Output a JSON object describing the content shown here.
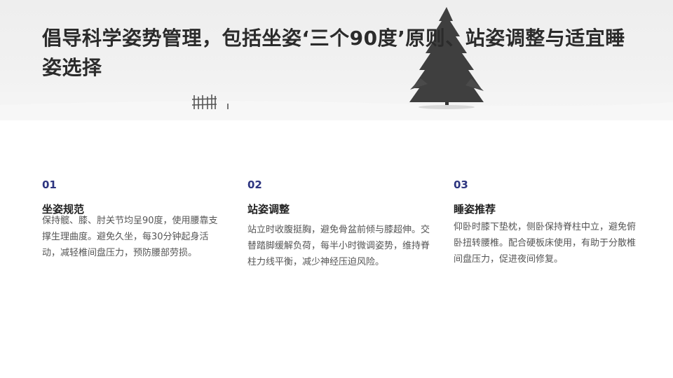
{
  "slide": {
    "title": "倡导科学姿势管理，包括坐姿‘三个90度’原则、站姿调整与适宜睡姿选择"
  },
  "hero_image": {
    "description_icon": "tree-icon",
    "fence_icon": "fence-icon"
  },
  "columns": [
    {
      "number": "01",
      "heading": "坐姿规范",
      "text": "保持髋、膝、肘关节均呈90度，使用腰靠支撑生理曲度。避免久坐，每30分钟起身活动，减轻椎间盘压力，预防腰部劳损。"
    },
    {
      "number": "02",
      "heading": "站姿调整",
      "text": "站立时收腹挺胸，避免骨盆前倾与膝超伸。交替踏脚缓解负荷，每半小时微调姿势，维持脊柱力线平衡，减少神经压迫风险。"
    },
    {
      "number": "03",
      "heading": "睡姿推荐",
      "text": "仰卧时膝下垫枕，侧卧保持脊柱中立，避免俯卧扭转腰椎。配合硬板床使用，有助于分散椎间盘压力，促进夜间修复。"
    }
  ],
  "colors": {
    "accent_number": "#2d3580",
    "title": "#2b2b2b",
    "heading": "#222222",
    "body": "#555555",
    "hero_bg": "#eeeeee"
  }
}
